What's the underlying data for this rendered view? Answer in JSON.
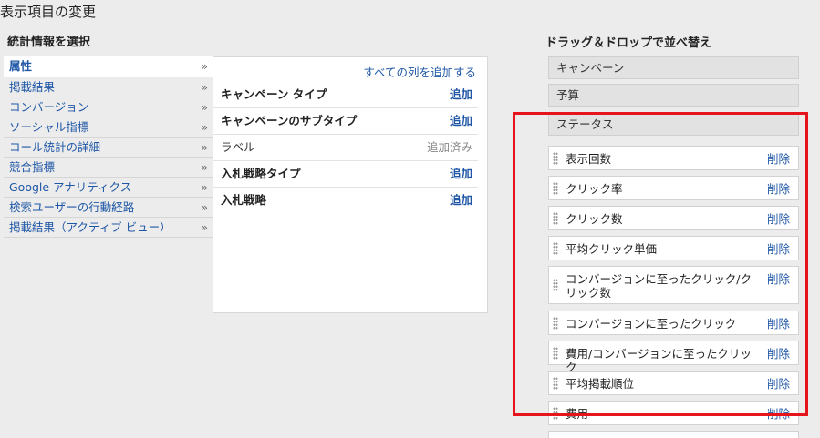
{
  "page_title": "表示項目の変更",
  "left_section_title": "統計情報を選択",
  "right_section_title": "ドラッグ＆ドロップで並べ替え",
  "categories": [
    {
      "label": "属性",
      "active": true
    },
    {
      "label": "掲載結果"
    },
    {
      "label": "コンバージョン"
    },
    {
      "label": "ソーシャル指標"
    },
    {
      "label": "コール統計の詳細"
    },
    {
      "label": "競合指標"
    },
    {
      "label": "Google アナリティクス"
    },
    {
      "label": "検索ユーザーの行動経路"
    },
    {
      "label": "掲載結果（アクティブ ビュー）"
    }
  ],
  "chevron": "»",
  "attributes": {
    "add_all": "すべての列を追加する",
    "rows": [
      {
        "label": "キャンペーン タイプ",
        "action": "追加"
      },
      {
        "label": "キャンペーンのサブタイプ",
        "action": "追加"
      },
      {
        "label": "ラベル",
        "action": "追加済み"
      },
      {
        "label": "入札戦略タイプ",
        "action": "追加"
      },
      {
        "label": "入札戦略",
        "action": "追加"
      }
    ]
  },
  "fixed_columns": [
    "キャンペーン",
    "予算",
    "ステータス"
  ],
  "draggable_columns": [
    {
      "label": "表示回数",
      "remove": "削除"
    },
    {
      "label": "クリック率",
      "remove": "削除"
    },
    {
      "label": "クリック数",
      "remove": "削除"
    },
    {
      "label": "平均クリック単価",
      "remove": "削除"
    },
    {
      "label": "コンバージョンに至ったクリック/クリック数",
      "remove": "削除"
    },
    {
      "label": "コンバージョンに至ったクリック",
      "remove": "削除"
    },
    {
      "label": "費用/コンバージョンに至ったクリック",
      "remove": "削除"
    },
    {
      "label": "平均掲載順位",
      "remove": "削除"
    },
    {
      "label": "費用",
      "remove": "削除"
    },
    {
      "label": "",
      "remove": ""
    }
  ],
  "colors": {
    "link": "#1f57a6",
    "highlight": "#e8141b"
  }
}
